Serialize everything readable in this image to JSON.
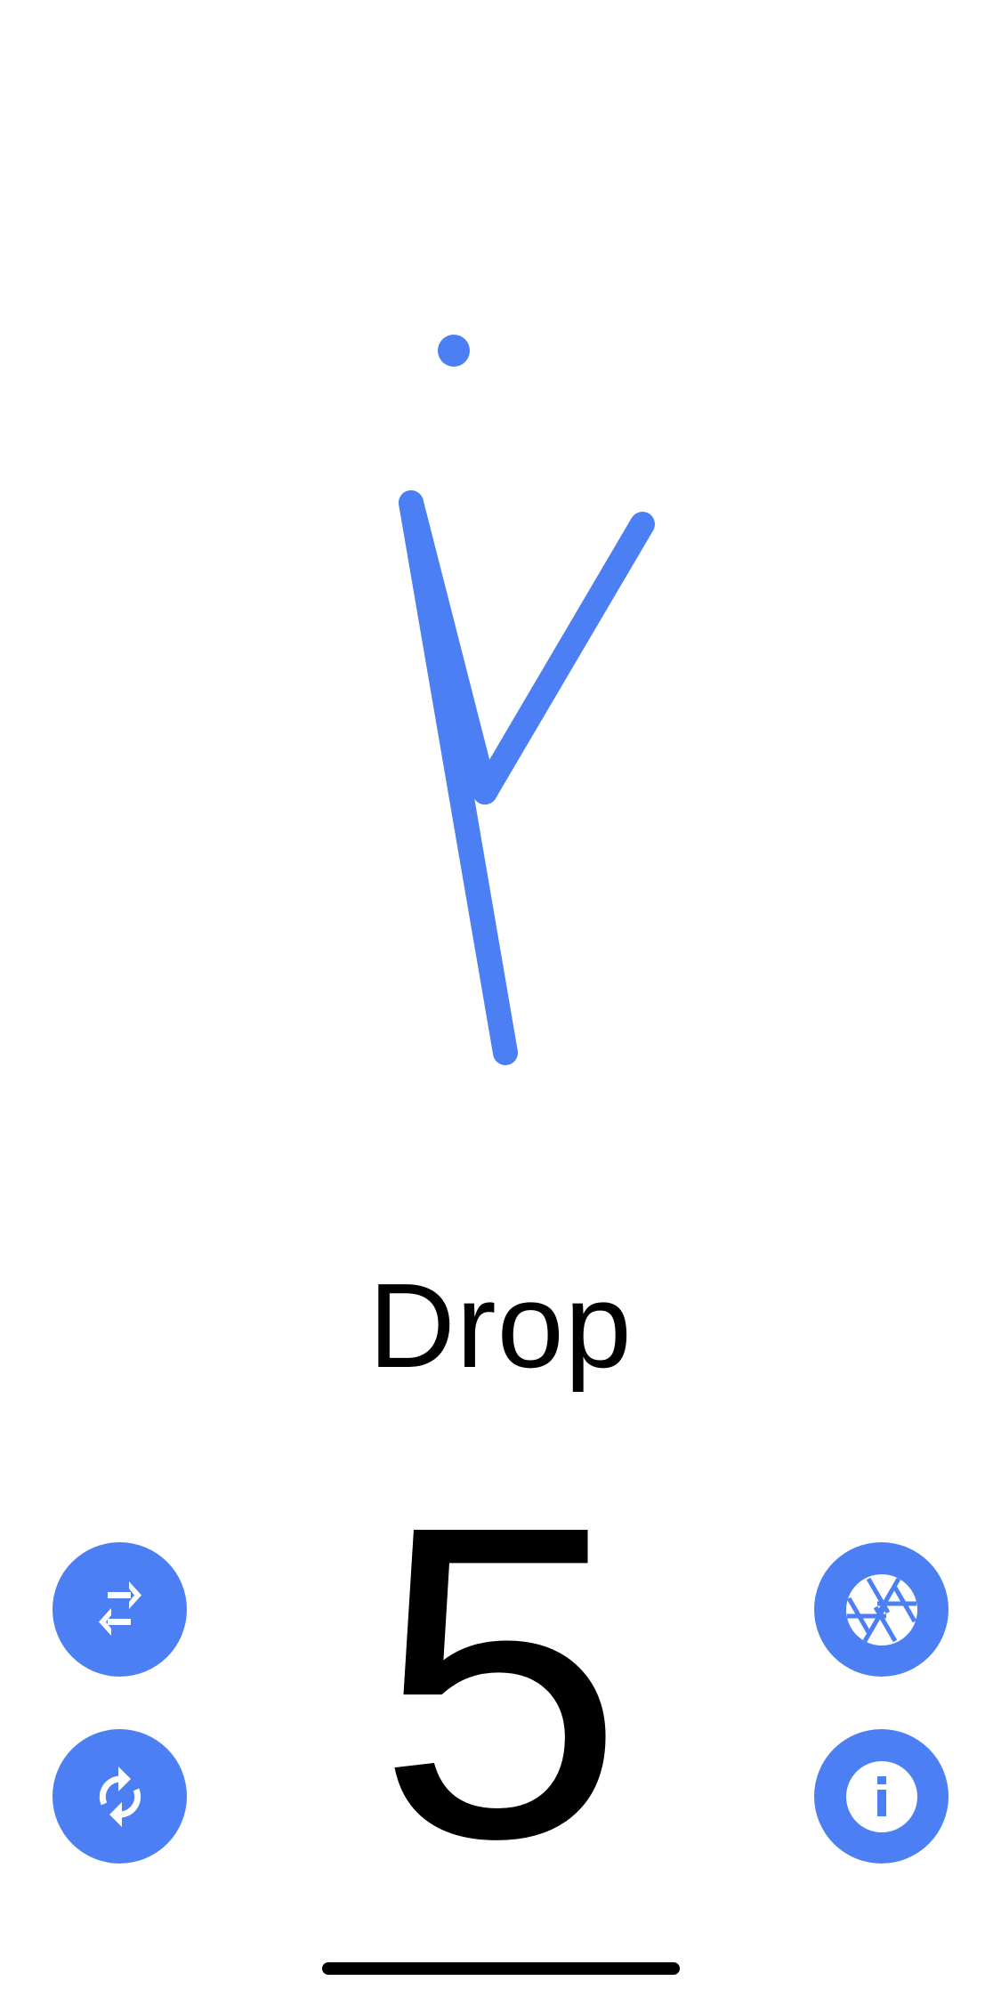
{
  "pose": {
    "label": "Drop",
    "count": "5"
  },
  "buttons": {
    "swap": {
      "icon": "swap-arrows-icon"
    },
    "refresh": {
      "icon": "refresh-icon"
    },
    "aperture": {
      "icon": "aperture-icon"
    },
    "info": {
      "icon": "info-icon"
    }
  },
  "colors": {
    "accent": "#4b7ff3",
    "text": "#000000",
    "background": "#ffffff"
  }
}
